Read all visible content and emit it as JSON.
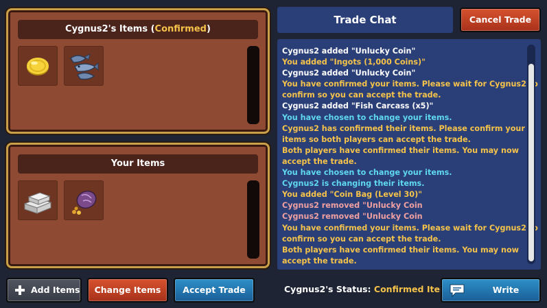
{
  "colors": {
    "panel_bg": "#8e4a33",
    "panel_border": "#c9a04a",
    "chat_bg": "#2a3f78",
    "confirmed_text": "#f6c34a",
    "chat_white": "#ffffff",
    "chat_yellow": "#f6c34a",
    "chat_cyan": "#5fd8f0",
    "chat_pink": "#f0a0a0",
    "button_red": "#c0421f",
    "button_blue": "#2478b3"
  },
  "their_panel": {
    "title_prefix": "Cygnus2's Items (",
    "title_status": "Confirmed",
    "title_suffix": ")",
    "items": [
      {
        "icon": "gold-coin-icon"
      },
      {
        "icon": "fish-carcass-icon"
      }
    ]
  },
  "your_panel": {
    "title": "Your Items",
    "items": [
      {
        "icon": "silver-ingots-icon"
      },
      {
        "icon": "coin-bag-icon"
      }
    ]
  },
  "chat": {
    "title": "Trade Chat",
    "messages": [
      {
        "text": "Cygnus2 added \"Unlucky Coin\"",
        "color": "#ffffff"
      },
      {
        "text": "You added \"Ingots (1,000 Coins)\"",
        "color": "#f6c34a"
      },
      {
        "text": "Cygnus2 added \"Unlucky Coin\"",
        "color": "#ffffff"
      },
      {
        "text": "You have confirmed your items. Please wait for Cygnus2 to",
        "color": "#f6c34a"
      },
      {
        "text": "confirm so you can accept the trade.",
        "color": "#f6c34a"
      },
      {
        "text": "Cygnus2 added \"Fish Carcass (x5)\"",
        "color": "#ffffff"
      },
      {
        "text": "You have chosen to change your items.",
        "color": "#5fd8f0"
      },
      {
        "text": "Cygnus2 has confirmed their items. Please confirm your",
        "color": "#f6c34a"
      },
      {
        "text": "items so both players can accept the trade.",
        "color": "#f6c34a"
      },
      {
        "text": "Both players have confirmed their items. You may now",
        "color": "#f6c34a"
      },
      {
        "text": "accept the trade.",
        "color": "#f6c34a"
      },
      {
        "text": "You have chosen to change your items.",
        "color": "#5fd8f0"
      },
      {
        "text": "Cygnus2 is changing their items.",
        "color": "#5fd8f0"
      },
      {
        "text": "You added \"Coin Bag (Level 30)\"",
        "color": "#f6c34a"
      },
      {
        "text": "Cygnus2 removed \"Unlucky Coin",
        "color": "#f0a0a0"
      },
      {
        "text": "Cygnus2 removed \"Unlucky Coin",
        "color": "#f0a0a0"
      },
      {
        "text": "You have confirmed your items. Please wait for Cygnus2 to",
        "color": "#f6c34a"
      },
      {
        "text": "confirm so you can accept the trade.",
        "color": "#f6c34a"
      },
      {
        "text": "Both players have confirmed their items. You may now",
        "color": "#f6c34a"
      },
      {
        "text": "accept the trade.",
        "color": "#f6c34a"
      }
    ]
  },
  "buttons": {
    "cancel_trade": "Cancel Trade",
    "add_items": "Add Items",
    "change_items": "Change Items",
    "accept_trade": "Accept Trade",
    "write_message": "Write Message"
  },
  "status": {
    "label": "Cygnus2's Status:",
    "value": "Confirmed Items"
  }
}
